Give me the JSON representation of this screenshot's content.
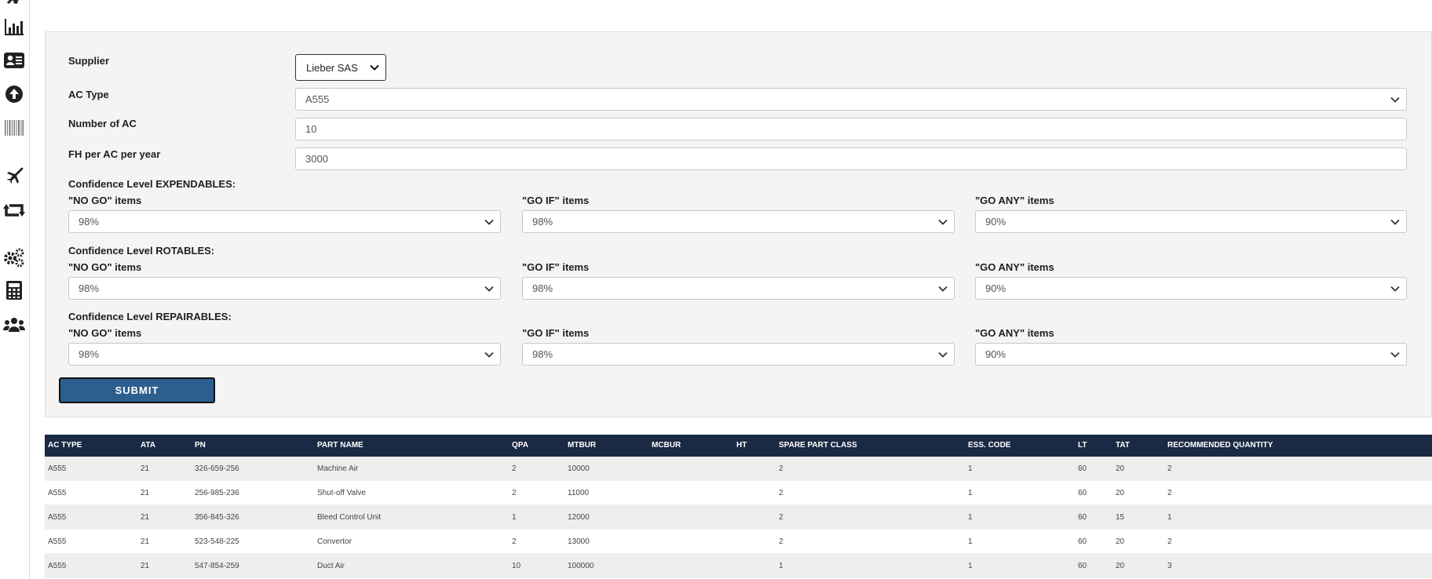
{
  "sidebar": {
    "icons": [
      "bar-chart-icon",
      "contact-card-icon",
      "upload-circle-icon",
      "barcode-icon",
      "airplane-icon",
      "retweet-icon",
      "gears-icon",
      "calculator-icon",
      "users-icon"
    ]
  },
  "form": {
    "supplier": {
      "label": "Supplier",
      "value": "Lieber SAS"
    },
    "ac_type": {
      "label": "AC Type",
      "value": "A555"
    },
    "num_ac": {
      "label": "Number of AC",
      "value": "10"
    },
    "fh": {
      "label": "FH per AC per year",
      "value": "3000"
    },
    "groups": [
      {
        "title": "Confidence Level EXPENDABLES:",
        "no_go": {
          "label": "\"NO GO\" items",
          "value": "98%"
        },
        "go_if": {
          "label": "\"GO IF\" items",
          "value": "98%"
        },
        "go_any": {
          "label": "\"GO ANY\" items",
          "value": "90%"
        }
      },
      {
        "title": "Confidence Level ROTABLES:",
        "no_go": {
          "label": "\"NO GO\" items",
          "value": "98%"
        },
        "go_if": {
          "label": "\"GO IF\" items",
          "value": "98%"
        },
        "go_any": {
          "label": "\"GO ANY\" items",
          "value": "90%"
        }
      },
      {
        "title": "Confidence Level REPAIRABLES:",
        "no_go": {
          "label": "\"NO GO\" items",
          "value": "98%"
        },
        "go_if": {
          "label": "\"GO IF\" items",
          "value": "98%"
        },
        "go_any": {
          "label": "\"GO ANY\" items",
          "value": "90%"
        }
      }
    ],
    "submit_label": "SUBMIT"
  },
  "table": {
    "headers": [
      "AC TYPE",
      "ATA",
      "PN",
      "PART NAME",
      "QPA",
      "MTBUR",
      "MCBUR",
      "HT",
      "SPARE PART CLASS",
      "ESS. CODE",
      "LT",
      "TAT",
      "RECOMMENDED QUANTITY"
    ],
    "rows": [
      [
        "A555",
        "21",
        "326-659-256",
        "Machine Air",
        "2",
        "10000",
        "",
        "",
        "2",
        "1",
        "60",
        "20",
        "2"
      ],
      [
        "A555",
        "21",
        "256-985-236",
        "Shut-off Valve",
        "2",
        "11000",
        "",
        "",
        "2",
        "1",
        "60",
        "20",
        "2"
      ],
      [
        "A555",
        "21",
        "356-845-326",
        "Bleed Control Unit",
        "1",
        "12000",
        "",
        "",
        "2",
        "1",
        "60",
        "15",
        "1"
      ],
      [
        "A555",
        "21",
        "523-548-225",
        "Convertor",
        "2",
        "13000",
        "",
        "",
        "2",
        "1",
        "60",
        "20",
        "2"
      ],
      [
        "A555",
        "21",
        "547-854-259",
        "Duct Air",
        "10",
        "100000",
        "",
        "",
        "1",
        "1",
        "60",
        "20",
        "3"
      ]
    ]
  }
}
